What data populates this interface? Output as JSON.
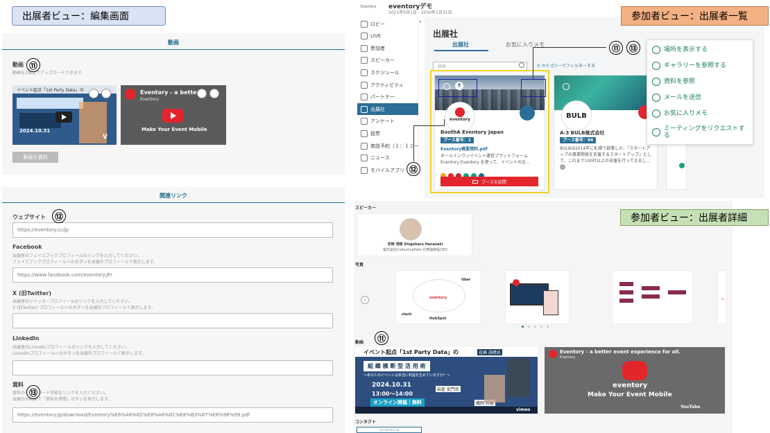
{
  "labels": {
    "exhibitor_view": "出展者ビュー：編集画面",
    "attendee_list": "参加者ビュー：出展者一覧",
    "attendee_detail": "参加者ビュー：出展者詳細"
  },
  "num": {
    "n11": "⑪",
    "n12": "⑫",
    "n13": "⑬"
  },
  "colors": {
    "label_blue": "#dae3f3",
    "label_orange": "#f4b183",
    "label_green": "#c5e0b4",
    "accent": "#1c6e8c",
    "highlight": "#f2d422",
    "red": "#e2262c"
  },
  "editor": {
    "video_section": "動画",
    "video_title": "動画",
    "video_desc": "動画を2個までアップロードできます",
    "thumb1_text": "イベント起点「1st Party Data」の",
    "thumb1_date": "2024.10.31",
    "thumb2_title": "Eventory - a better...",
    "thumb2_sub": "Eventory",
    "thumb2_tag": "Make Your Event Mobile",
    "select_video": "動画を選択",
    "links_section": "関連リンク",
    "website_label": "ウェブサイト",
    "website_value": "https://eventory.cc/jp",
    "facebook_label": "Facebook",
    "facebook_desc1": "出展者のフェイスブックプロフィールのリンクを入力してください。",
    "facebook_desc2": "フェイスブックプロフィールへのボタンを出展社プロフィールで表示します。",
    "facebook_value": "https://www.facebook.com/eventory.JP/",
    "twitter_label": "X (旧Twitter)",
    "twitter_desc1": "出展者のツイッタープロフィールのリンクを入力してください。",
    "twitter_desc2": "X (旧Twitter) プロフィールへのボタンを出展社プロフィールで表示します。",
    "linkedin_label": "LinkedIn",
    "linkedin_desc1": "出展者のLinkedInプロフィールのリンクを入力してください。",
    "linkedin_desc2": "LinkedInプロフィールへのボタンを出展社プロフィールで表示します。",
    "doc_label": "資料",
    "doc_desc1": "資料のダウンロード可能なリンクを入力ください。",
    "doc_desc2": "出展社の画面で「資料を参照」ボタンを表示します。",
    "doc_value": "https://eventory.jp/download/Eventory%E6%A6%82%E8%A6%81%E8%B3%87%E6%96%99.pdf"
  },
  "list": {
    "brand": "eventoryデモ",
    "date_range": "2021年5月1日 - 2030年1月31日",
    "logo_small": "Eventory",
    "sidebar": [
      "ロビー",
      "LIVE",
      "参加者",
      "スピーカー",
      "スケジュール",
      "アクティビティ",
      "パートナー",
      "出展社",
      "アンケート",
      "投票",
      "商談予約（１：１ミーティング）",
      "ニュース",
      "モバイルアプリ"
    ],
    "page_title": "出展社",
    "tab1": "出展社",
    "tab2": "お気に入りメモ",
    "search_placeholder": "検索",
    "filter": "カテゴリーでフィルターする",
    "card1_name": "BoothA Eventory Japan",
    "card1_booth": "ブース番号：1",
    "card1_link": "Eventory概要資料.pdf",
    "card1_desc": "オールインワンイベント運営プラットフォーム Eventory Eventory を使って、イベントの企...",
    "card1_logo": "eventory",
    "card1_button": "ブースを訪問",
    "card2_name": "A-3 BULB株式会社",
    "card2_booth": "ブース番号：94",
    "card2_desc": "BULBは2014年に札幌で創業した、「スタートアップの事業開発を支援するスタートアップ」として、これまで100社以上の支援を行ってきまし...",
    "card2_logo": "BULB",
    "menu": [
      "場所を表示する",
      "ギャラリーを参照する",
      "資料を参照",
      "メールを送信",
      "お気に入りメモ",
      "ミーティングをリクエストする"
    ],
    "dots": [
      "#f0a020",
      "#e2262c",
      "#c0282c",
      "#1aa07a",
      "#1aa07a",
      "#1c6e8c"
    ]
  },
  "detail": {
    "speaker_section": "スピーカー",
    "speaker_name": "花崎 茂晴 Shigeharu Hanazaki",
    "speaker_title": "株式会社CollectivePath 代表取締役CEO",
    "photo_section": "写真",
    "video_section": "動画",
    "v1_title": "イベント起点「1st Party Data」の",
    "v1_row2": "組 織 横 断 型 活 用 術",
    "v1_sub": "〜あなたのイベントは本当に利益を生めていますか？〜",
    "v1_date": "2024.10.31",
    "v1_time": "13:00〜14:00",
    "v1_online": "オンライン開催｜無料",
    "v1_speaker": "花崎 茂晴氏",
    "v1_speaker2": "岩倉 史門氏",
    "v1_speaker3": "橋岡 和樹",
    "v1_vimeo": "vimeo",
    "v2_title": "Eventory - a better event experience for all.",
    "v2_sub": "Eventory",
    "v2_logo": "eventory",
    "v2_tag": "Make Your Event Mobile",
    "v2_yt": "YouTube",
    "contact_section": "コンタクト",
    "contact_btn": "メールアドレス",
    "hub": [
      "slack",
      "HubSpot",
      "eventory",
      "Uber"
    ]
  }
}
